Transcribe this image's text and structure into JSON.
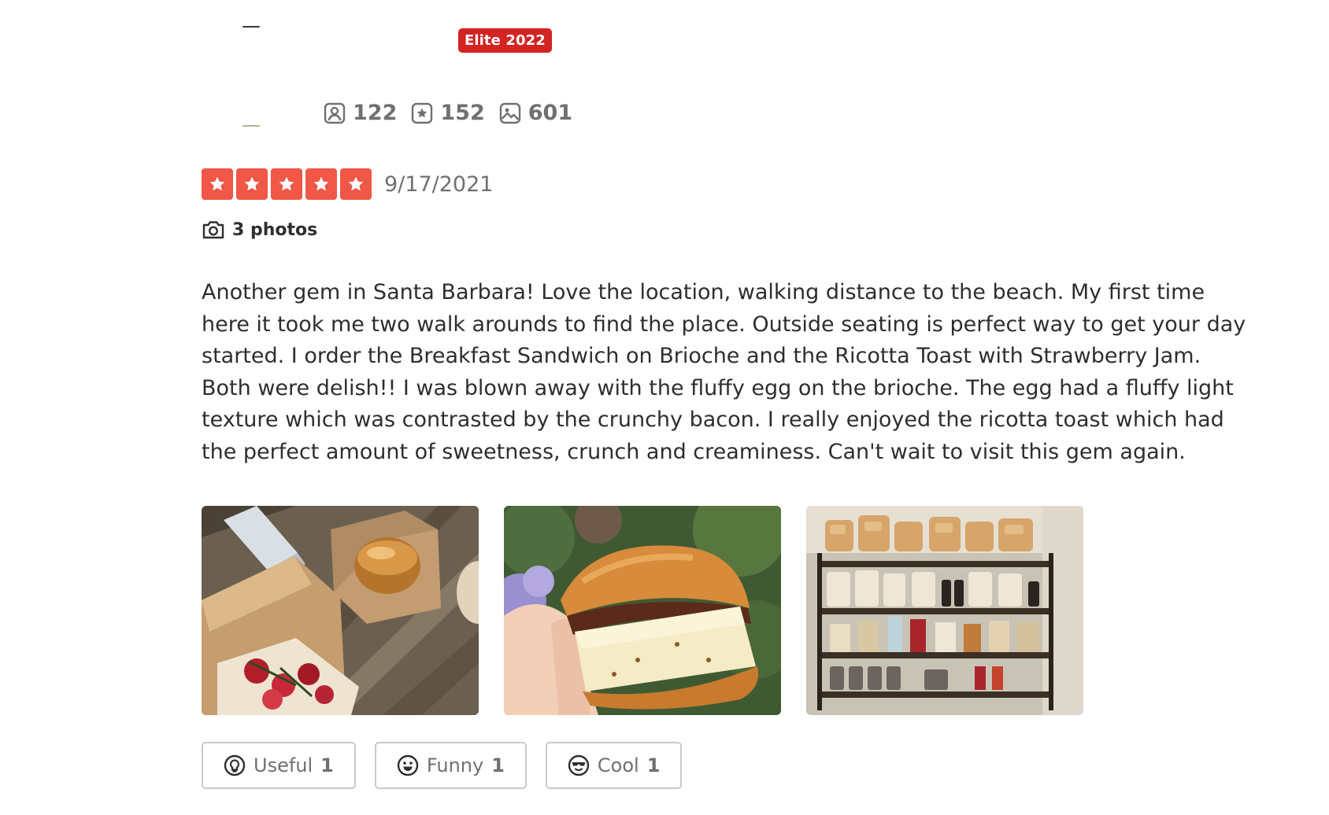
{
  "user": {
    "elite_badge": "Elite 2022",
    "stats": {
      "friends": "122",
      "reviews": "152",
      "photos": "601"
    }
  },
  "review": {
    "rating": 5,
    "date": "9/17/2021",
    "photos_link": "3 photos",
    "text": "Another gem in Santa Barbara! Love the location, walking distance to the beach. My first time here it took me two walk arounds to find the place. Outside seating is perfect way to get your day started. I order the Breakfast Sandwich on Brioche and the Ricotta Toast with Strawberry Jam. Both were delish!! I was blown away with the fluffy egg on the brioche. The egg had a fluffy light texture which was contrasted by the crunchy bacon. I really enjoyed the ricotta toast which had the perfect amount of sweetness, crunch and creaminess. Can't wait to visit this gem again.",
    "photos": [
      {
        "icon": "photo-takeout-boxes"
      },
      {
        "icon": "photo-breakfast-sandwich"
      },
      {
        "icon": "photo-bakery-shelf"
      }
    ]
  },
  "reactions": {
    "useful": {
      "label": "Useful",
      "count": "1",
      "icon": "lightbulb-icon"
    },
    "funny": {
      "label": "Funny",
      "count": "1",
      "icon": "smile-icon"
    },
    "cool": {
      "label": "Cool",
      "count": "1",
      "icon": "sunglasses-icon"
    }
  },
  "colors": {
    "star": "#f05747",
    "elite": "#d32323",
    "muted_text": "#6e7072",
    "body_text": "#2d2e2f"
  }
}
